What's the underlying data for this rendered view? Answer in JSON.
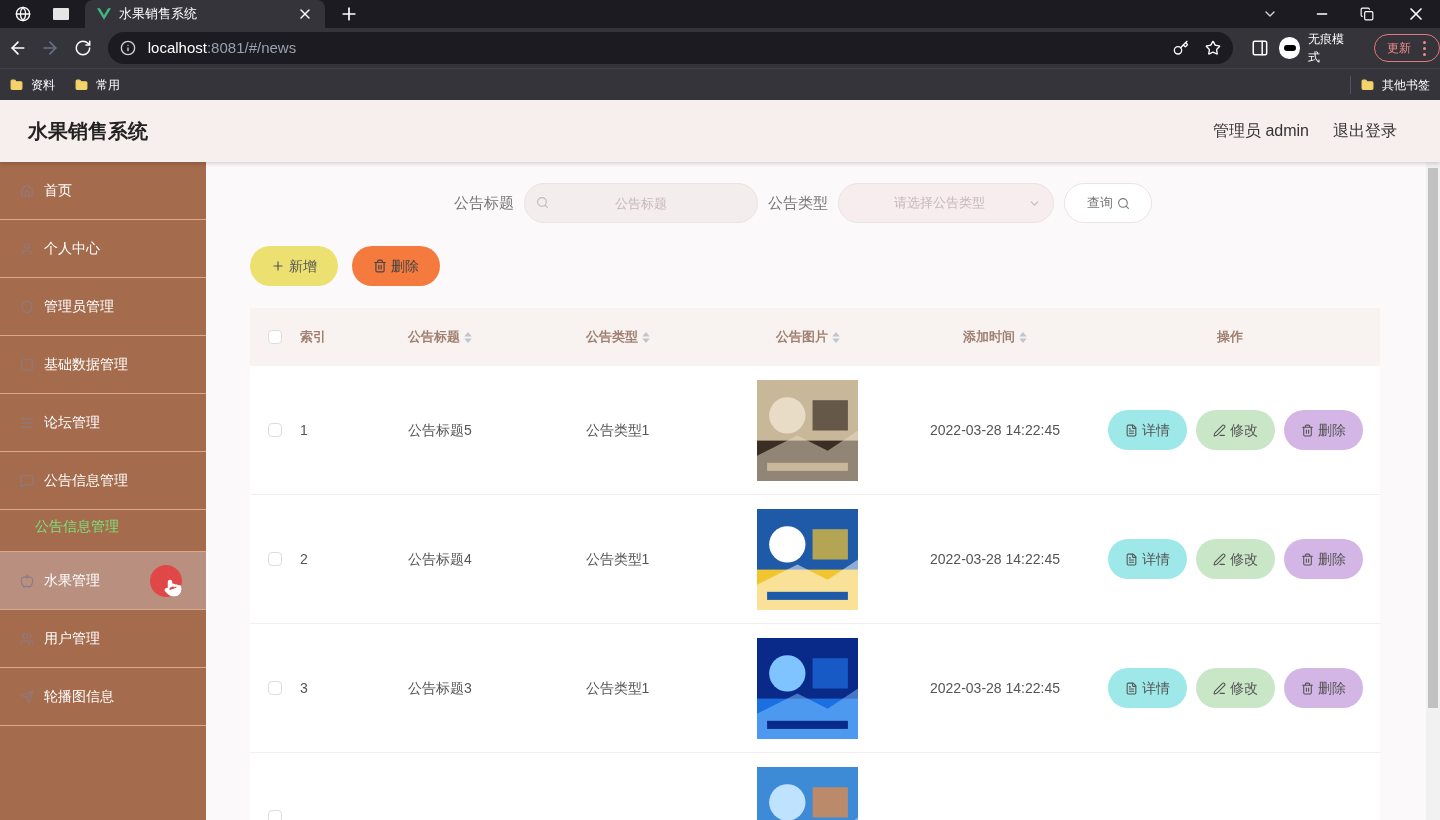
{
  "browser": {
    "tab_title": "水果销售系统",
    "url_host": "localhost",
    "url_rest": ":8081/#/news",
    "profile_label": "无痕模式",
    "update_label": "更新",
    "bookmarks": [
      "资料",
      "常用"
    ],
    "other_bookmarks": "其他书签"
  },
  "header": {
    "title": "水果销售系统",
    "user": "管理员 admin",
    "logout": "退出登录"
  },
  "sidebar": {
    "items": [
      {
        "label": "首页",
        "kind": "home",
        "hovered": false
      },
      {
        "label": "个人中心",
        "kind": "user",
        "hovered": false
      },
      {
        "label": "管理员管理",
        "kind": "admin",
        "hovered": false
      },
      {
        "label": "基础数据管理",
        "kind": "data",
        "hovered": false
      },
      {
        "label": "论坛管理",
        "kind": "list",
        "hovered": false
      },
      {
        "label": "公告信息管理",
        "kind": "chat",
        "hovered": false,
        "children": [
          {
            "label": "公告信息管理",
            "selected": true
          }
        ]
      },
      {
        "label": "水果管理",
        "kind": "fruit",
        "hovered": true
      },
      {
        "label": "用户管理",
        "kind": "users",
        "hovered": false
      },
      {
        "label": "轮播图信息",
        "kind": "send",
        "hovered": false
      }
    ]
  },
  "search": {
    "title_label": "公告标题",
    "title_placeholder": "公告标题",
    "type_label": "公告类型",
    "type_placeholder": "请选择公告类型",
    "query_button": "查询"
  },
  "actions": {
    "add": "新增",
    "delete": "删除"
  },
  "table": {
    "select_all_checked": false,
    "columns": [
      "索引",
      "公告标题",
      "公告类型",
      "公告图片",
      "添加时间",
      "操作"
    ],
    "rows": [
      {
        "index": "1",
        "title": "公告标题5",
        "type": "公告类型1",
        "image": {
          "kind": "picture"
        },
        "time": "2022-03-28 14:22:45",
        "checked": false,
        "buttons": [
          "详情",
          "修改",
          "删除"
        ]
      },
      {
        "index": "2",
        "title": "公告标题4",
        "type": "公告类型1",
        "image": {
          "kind": "picture"
        },
        "time": "2022-03-28 14:22:45",
        "checked": false,
        "buttons": [
          "详情",
          "修改",
          "删除"
        ]
      },
      {
        "index": "3",
        "title": "公告标题3",
        "type": "公告类型1",
        "image": {
          "kind": "picture"
        },
        "time": "2022-03-28 14:22:45",
        "checked": false,
        "buttons": [
          "详情",
          "修改",
          "删除"
        ]
      },
      {
        "image": {
          "kind": "picture"
        },
        "checked": false
      }
    ]
  }
}
